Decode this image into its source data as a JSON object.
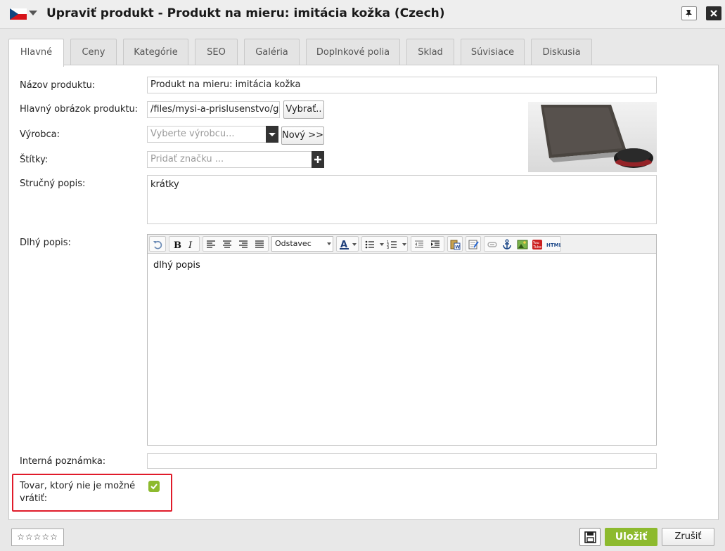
{
  "window": {
    "title": "Upraviť produkt - Produkt na mieru: imitácia kožka (Czech)"
  },
  "tabs": [
    {
      "label": "Hlavné",
      "active": true
    },
    {
      "label": "Ceny"
    },
    {
      "label": "Kategórie"
    },
    {
      "label": "SEO"
    },
    {
      "label": "Galéria"
    },
    {
      "label": "Doplnkové polia"
    },
    {
      "label": "Sklad"
    },
    {
      "label": "Súvisiace"
    },
    {
      "label": "Diskusia"
    }
  ],
  "form": {
    "name_label": "Názov produktu:",
    "name_value": "Produkt na mieru: imitácia kožka",
    "image_label": "Hlavný obrázok produktu:",
    "image_value": "/files/mysi-a-prislusenstvo/ger",
    "select_button": "Vybrať..",
    "manufacturer_label": "Výrobca:",
    "manufacturer_placeholder": "Vyberte výrobcu...",
    "new_button": "Nový >>",
    "tags_label": "Štítky:",
    "tags_placeholder": "Pridať značku ...",
    "short_desc_label": "Stručný popis:",
    "short_desc_value": "krátky",
    "long_desc_label": "Dlhý popis:",
    "long_desc_value": "dlhý popis",
    "format_value": "Odstavec",
    "internal_note_label": "Interná poznámka:",
    "internal_note_value": "",
    "nonreturnable_label": "Tovar, ktorý nie je možné vrátiť:",
    "nonreturnable_checked": true
  },
  "footer": {
    "rating": "☆☆☆☆☆",
    "save_label": "Uložiť",
    "cancel_label": "Zrušiť"
  },
  "colors": {
    "accent_green": "#8dba2e",
    "highlight_red": "#e01b2a"
  }
}
